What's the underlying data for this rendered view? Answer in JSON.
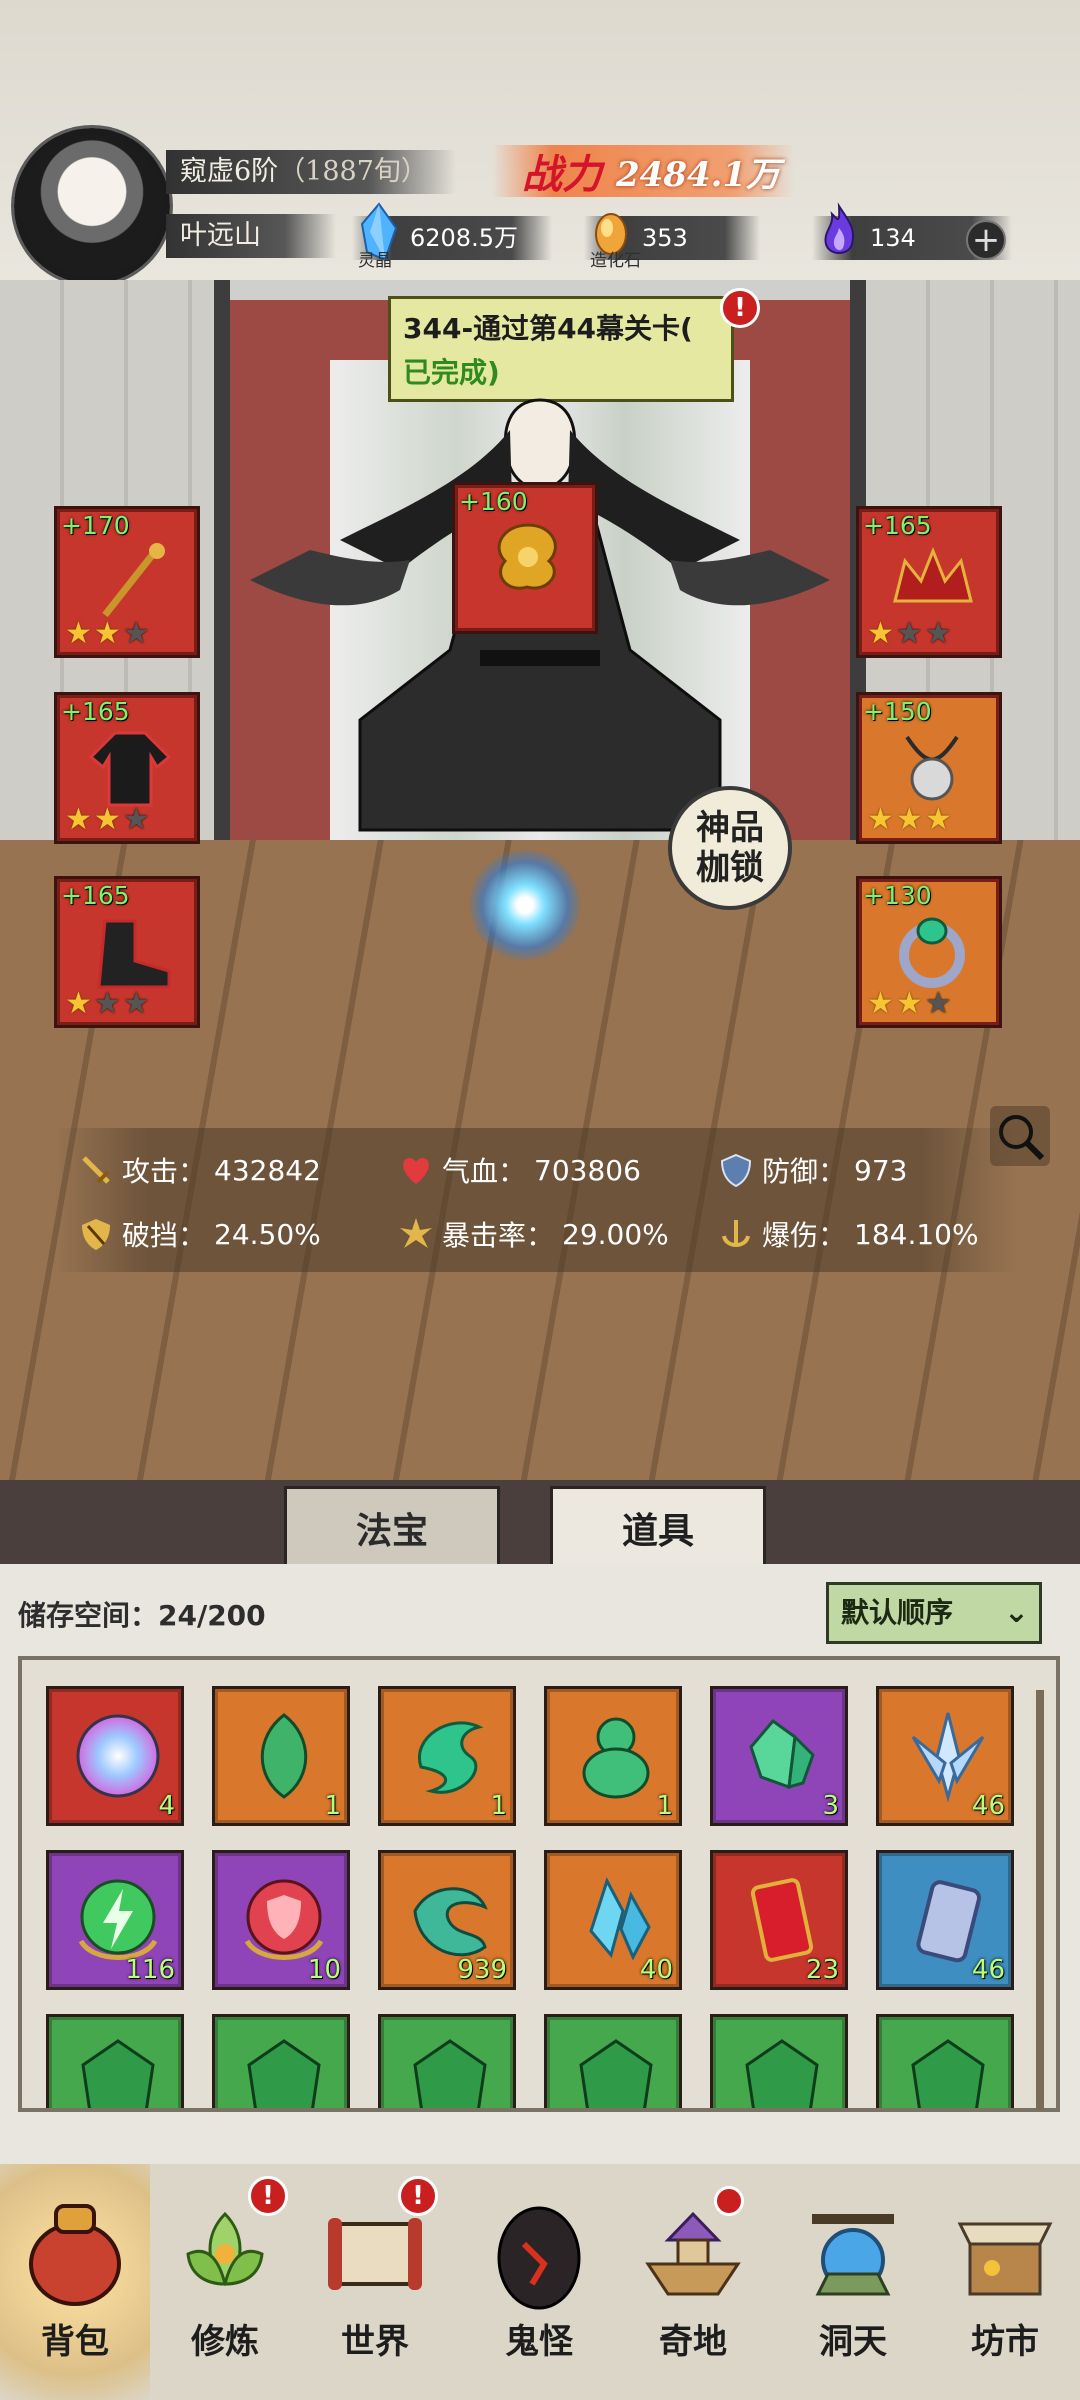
{
  "player": {
    "realm": "窥虚6阶",
    "age": "（1887旬）",
    "name": "叶远山",
    "power_label": "战力",
    "power_value": "2484.1万"
  },
  "resources": {
    "lingjing": {
      "value": "6208.5万",
      "caption": "灵晶",
      "icon": "blue-crystal-icon",
      "color": "#4fb3ff"
    },
    "zaohua": {
      "value": "353",
      "caption": "造化石",
      "icon": "golden-stone-icon",
      "color": "#f0a53a"
    },
    "soul": {
      "value": "134",
      "icon": "purple-flame-icon",
      "color": "#6a3ce0"
    },
    "add_label": "+"
  },
  "quest": {
    "title": "344-通过第44幕关卡(",
    "status": "已完成)",
    "alert": "!"
  },
  "equipment": [
    {
      "slot": "left-1",
      "level": "+170",
      "stars": 2,
      "rarity": "red",
      "icon": "staff-icon"
    },
    {
      "slot": "left-2",
      "level": "+165",
      "stars": 2,
      "rarity": "red",
      "icon": "robe-icon"
    },
    {
      "slot": "left-3",
      "level": "+165",
      "stars": 1,
      "rarity": "red",
      "icon": "boots-icon"
    },
    {
      "slot": "center",
      "level": "+160",
      "stars": 0,
      "rarity": "red",
      "icon": "golden-cloud-icon"
    },
    {
      "slot": "right-1",
      "level": "+165",
      "stars": 1,
      "rarity": "red",
      "icon": "crown-icon"
    },
    {
      "slot": "right-2",
      "level": "+150",
      "stars": 3,
      "rarity": "orange",
      "icon": "amulet-icon"
    },
    {
      "slot": "right-3",
      "level": "+130",
      "stars": 2,
      "rarity": "orange",
      "icon": "ring-icon"
    }
  ],
  "shackle_badge": [
    "神品",
    "枷锁"
  ],
  "stats": {
    "attack": {
      "label": "攻击：",
      "value": "432842"
    },
    "hp": {
      "label": "气血：",
      "value": "703806"
    },
    "defense": {
      "label": "防御：",
      "value": "973"
    },
    "break": {
      "label": "破挡：",
      "value": "24.50%"
    },
    "crit_rate": {
      "label": "暴击率：",
      "value": "29.00%"
    },
    "crit_dmg": {
      "label": "爆伤：",
      "value": "184.10%"
    }
  },
  "tabs": [
    {
      "label": "法宝"
    },
    {
      "label": "道具"
    }
  ],
  "inventory": {
    "storage_label": "储存空间：24/200",
    "sort_label": "默认顺序",
    "items": [
      {
        "rarity": "red",
        "icon": "rainbow-orb-icon",
        "count": "4"
      },
      {
        "rarity": "orange",
        "icon": "green-leaf-gem-icon",
        "count": "1"
      },
      {
        "rarity": "orange",
        "icon": "green-swirl-gem-icon",
        "count": "1"
      },
      {
        "rarity": "orange",
        "icon": "jade-gourd-icon",
        "count": "1"
      },
      {
        "rarity": "purple",
        "icon": "green-crystal-icon",
        "count": "3"
      },
      {
        "rarity": "orange",
        "icon": "ice-crystal-icon",
        "count": "46"
      },
      {
        "rarity": "purple",
        "icon": "lightning-orb-icon",
        "count": "116"
      },
      {
        "rarity": "purple",
        "icon": "shield-orb-icon",
        "count": "10"
      },
      {
        "rarity": "orange",
        "icon": "green-wind-icon",
        "count": "939"
      },
      {
        "rarity": "orange",
        "icon": "blue-crystal-cluster-icon",
        "count": "40"
      },
      {
        "rarity": "red",
        "icon": "red-talisman-icon",
        "count": "23"
      },
      {
        "rarity": "blue",
        "icon": "silver-scroll-icon",
        "count": "46"
      },
      {
        "rarity": "green",
        "icon": "green-token-icon",
        "count": ""
      },
      {
        "rarity": "green",
        "icon": "green-token-icon",
        "count": ""
      },
      {
        "rarity": "green",
        "icon": "green-token-icon",
        "count": ""
      },
      {
        "rarity": "green",
        "icon": "green-token-icon",
        "count": ""
      },
      {
        "rarity": "green",
        "icon": "green-token-icon",
        "count": ""
      },
      {
        "rarity": "green",
        "icon": "green-token-icon",
        "count": ""
      }
    ]
  },
  "bottom_nav": [
    {
      "label": "背包",
      "icon": "bag-icon",
      "alert": false
    },
    {
      "label": "修炼",
      "icon": "lotus-icon",
      "alert": true
    },
    {
      "label": "世界",
      "icon": "scroll-map-icon",
      "alert": true
    },
    {
      "label": "鬼怪",
      "icon": "ghost-egg-icon",
      "alert": false
    },
    {
      "label": "奇地",
      "icon": "floating-temple-icon",
      "alert": true
    },
    {
      "label": "洞天",
      "icon": "portal-gate-icon",
      "alert": false
    },
    {
      "label": "坊市",
      "icon": "market-stall-icon",
      "alert": false
    }
  ]
}
